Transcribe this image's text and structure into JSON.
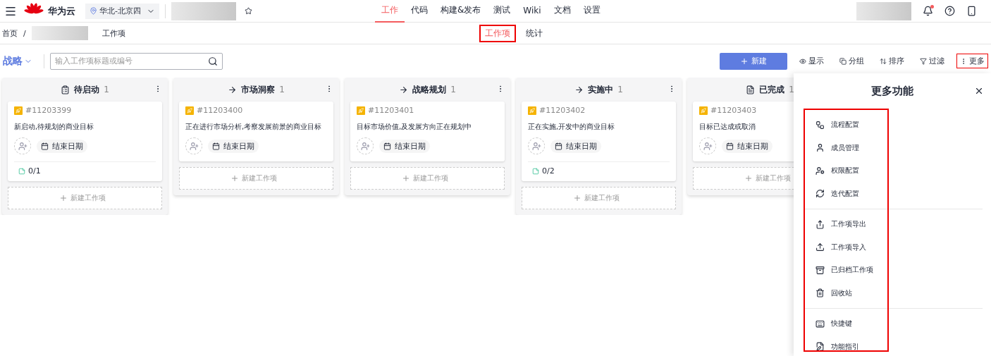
{
  "topbar": {
    "brand": "华为云",
    "region": "华北-北京四",
    "nav": [
      {
        "label": "工作",
        "selected": true
      },
      {
        "label": "代码",
        "selected": false
      },
      {
        "label": "构建&发布",
        "selected": false
      },
      {
        "label": "测试",
        "selected": false
      },
      {
        "label": "Wiki",
        "selected": false
      },
      {
        "label": "文档",
        "selected": false
      },
      {
        "label": "设置",
        "selected": false
      }
    ],
    "has_unread": true
  },
  "breadcrumb": {
    "home": "首页",
    "separator": "/",
    "current": "工作项"
  },
  "tabs": [
    {
      "label": "工作项",
      "selected": true,
      "highlighted": true
    },
    {
      "label": "统计",
      "selected": false,
      "highlighted": false
    }
  ],
  "toolbar": {
    "view": "战略",
    "search_placeholder": "输入工作项标题或编号",
    "new_button": "新建",
    "actions": [
      {
        "kind": "eye",
        "label": "显示",
        "highlighted": false
      },
      {
        "kind": "group",
        "label": "分组",
        "highlighted": false
      },
      {
        "kind": "sort",
        "label": "排序",
        "highlighted": false
      },
      {
        "kind": "filter",
        "label": "过滤",
        "highlighted": false
      },
      {
        "kind": "more",
        "label": "更多",
        "highlighted": true
      }
    ]
  },
  "columns": [
    {
      "kind": "start",
      "title": "待启动",
      "count": "1",
      "cards": [
        {
          "id": "#11203399",
          "title": "新启动,待规划的商业目标",
          "date": "结束日期",
          "progress": "0/1"
        }
      ],
      "add_label": "新建工作项"
    },
    {
      "kind": "arrow",
      "title": "市场洞察",
      "count": "1",
      "cards": [
        {
          "id": "#11203400",
          "title": "正在进行市场分析,考察发展前景的商业目标",
          "date": "结束日期"
        }
      ],
      "add_label": "新建工作项"
    },
    {
      "kind": "arrow",
      "title": "战略规划",
      "count": "1",
      "cards": [
        {
          "id": "#11203401",
          "title": "目标市场价值,及发展方向正在规划中",
          "date": "结束日期"
        }
      ],
      "add_label": "新建工作项"
    },
    {
      "kind": "arrow",
      "title": "实施中",
      "count": "1",
      "cards": [
        {
          "id": "#11203402",
          "title": "正在实施,开发中的商业目标",
          "date": "结束日期",
          "progress": "0/2"
        }
      ],
      "add_label": "新建工作项"
    },
    {
      "kind": "done",
      "title": "已完成",
      "count": "1",
      "cards": [
        {
          "id": "#11203403",
          "title": "目标已达成或取消",
          "date": "结束日期"
        }
      ],
      "add_label": "新建工作项"
    }
  ],
  "panel": {
    "title": "更多功能",
    "groups": [
      [
        {
          "kind": "flow",
          "label": "流程配置"
        },
        {
          "kind": "member",
          "label": "成员管理"
        },
        {
          "kind": "permission",
          "label": "权限配置"
        },
        {
          "kind": "iteration",
          "label": "迭代配置"
        }
      ],
      [
        {
          "kind": "export",
          "label": "工作项导出"
        },
        {
          "kind": "import",
          "label": "工作项导入"
        },
        {
          "kind": "archive",
          "label": "已归档工作项"
        },
        {
          "kind": "trash",
          "label": "回收站"
        }
      ],
      [
        {
          "kind": "keyboard",
          "label": "快捷键"
        },
        {
          "kind": "guide",
          "label": "功能指引"
        }
      ]
    ]
  }
}
